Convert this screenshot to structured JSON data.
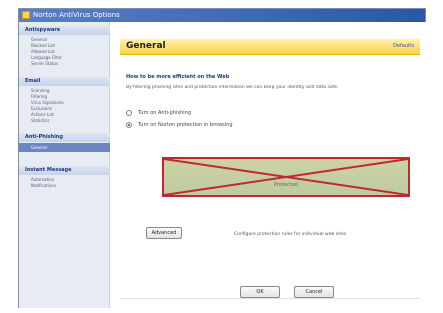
{
  "window": {
    "title": "Norton AntiVirus Options"
  },
  "sidebar": {
    "sections": [
      {
        "title": "Antispyware",
        "items": [
          "General",
          "Blocked List",
          "Allowed List",
          "Language Filter",
          "Server Status"
        ]
      },
      {
        "title": "Email",
        "items": [
          "Scanning",
          "Filtering",
          "Virus Signatures",
          "Exclusions",
          "Actions List",
          "Statistics"
        ]
      },
      {
        "title": "Anti-Phishing",
        "items": [
          "General"
        ]
      },
      {
        "title": "Instant Message",
        "items": [
          "Automation",
          "Notifications"
        ]
      }
    ],
    "selected": "General"
  },
  "main": {
    "title": "General",
    "header_link": "Defaults",
    "subheading": "How to be more efficient on the Web",
    "description": "By filtering phishing sites and protection information we can keep your identity and data safe.",
    "radios": [
      {
        "label": "Turn on Anti-phishing",
        "checked": false
      },
      {
        "label": "Turn on Norton protection in browsing",
        "checked": true
      }
    ],
    "banner_label": "Protected",
    "advanced_button": "Advanced",
    "advanced_description": "Configure protection rules for individual web sites",
    "ok_button": "OK",
    "cancel_button": "Cancel"
  },
  "colors": {
    "accent": "#2b56a8",
    "header_yellow": "#ffd24d",
    "banner_border": "#c0282f",
    "sidebar_selected": "#6c86c4"
  },
  "icons": [
    "app-icon",
    "radio-icon",
    "crossed-out-banner"
  ]
}
